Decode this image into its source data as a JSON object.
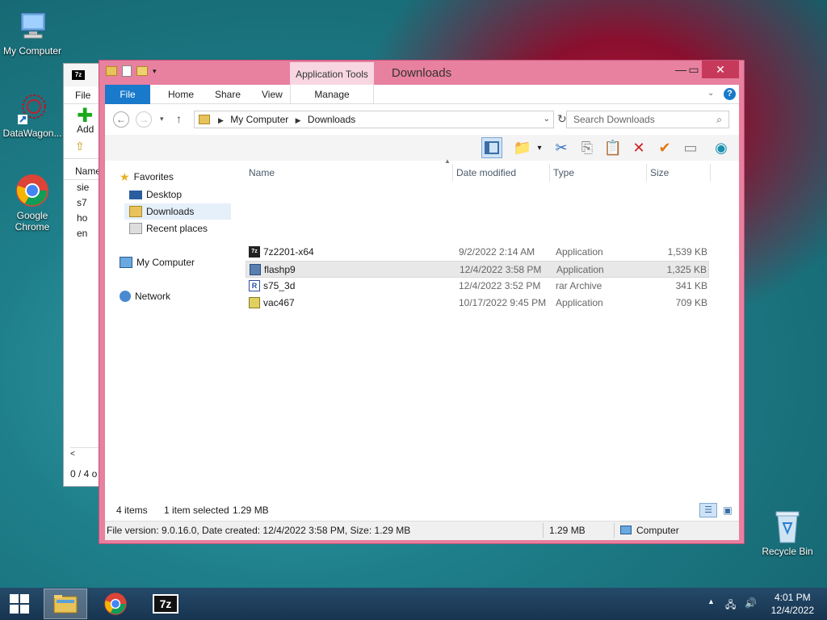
{
  "desktop": {
    "icons": [
      {
        "label": "My Computer"
      },
      {
        "label": "DataWagon..."
      },
      {
        "label": "Google Chrome"
      },
      {
        "label": "Recycle Bin"
      }
    ]
  },
  "bg_window": {
    "menu": "File",
    "add_label": "Add",
    "column": "Name",
    "rows": [
      "sie",
      "s7",
      "ho",
      "en"
    ],
    "status": "0 / 4 o"
  },
  "window": {
    "title": "Downloads",
    "application_tools": "Application Tools",
    "ribbon_tabs": {
      "file": "File",
      "home": "Home",
      "share": "Share",
      "view": "View",
      "manage": "Manage"
    },
    "address": {
      "parts": [
        "My Computer",
        "Downloads"
      ]
    },
    "search_placeholder": "Search Downloads",
    "nav": {
      "favorites": "Favorites",
      "desktop": "Desktop",
      "downloads": "Downloads",
      "recent": "Recent places",
      "computer": "My Computer",
      "network": "Network"
    },
    "columns": {
      "name": "Name",
      "date": "Date modified",
      "type": "Type",
      "size": "Size"
    },
    "files": [
      {
        "name": "7z2201-x64",
        "date": "9/2/2022 2:14 AM",
        "type": "Application",
        "size": "1,539 KB"
      },
      {
        "name": "flashp9",
        "date": "12/4/2022 3:58 PM",
        "type": "Application",
        "size": "1,325 KB"
      },
      {
        "name": "s75_3d",
        "date": "12/4/2022 3:52 PM",
        "type": "rar Archive",
        "size": "341 KB"
      },
      {
        "name": "vac467",
        "date": "10/17/2022 9:45 PM",
        "type": "Application",
        "size": "709 KB"
      }
    ],
    "status": {
      "items": "4 items",
      "selected": "1 item selected",
      "selected_size": "1.29 MB",
      "file_info": "File version: 9.0.16.0, Date created: 12/4/2022 3:58 PM, Size: 1.29 MB",
      "size": "1.29 MB",
      "location": "Computer"
    }
  },
  "taskbar": {
    "time": "4:01 PM",
    "date": "12/4/2022"
  },
  "colors": {
    "window_frame": "#e8809f",
    "file_tab": "#1979ca",
    "taskbar": "#1e3e5e"
  }
}
